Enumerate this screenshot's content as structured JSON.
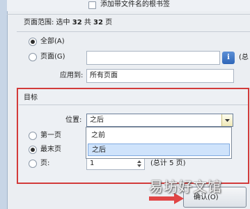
{
  "options": {
    "add_bookmark_checkbox_label": "添加带文件名的根书签"
  },
  "page_range": {
    "heading": "页面范围: 选中",
    "selected_count": "32",
    "total_word": "共",
    "total_count": "32",
    "unit": "页",
    "all_radio_label": "全部(A)",
    "pages_radio_label": "页面(G)",
    "pages_input_value": "",
    "total_hint_partial": "(总",
    "info_icon": "info-icon",
    "apply_to_label": "应用到:",
    "apply_to_value": "所有页面"
  },
  "target": {
    "group_title": "目标",
    "position_label": "位置:",
    "position_value": "之后",
    "first_page_label": "第一页",
    "last_page_label": "最末页",
    "page_label": "页:",
    "page_spinner_value": "1",
    "page_total_hint": "(总计 5 页)",
    "dropdown_options": [
      "之前",
      "之后"
    ],
    "dropdown_selected_index": 1
  },
  "footer": {
    "ok_button_label": "确认(O)"
  },
  "watermark": "易坊好文馆",
  "colors": {
    "highlight_border": "#d23a3a",
    "arrow": "#e04545",
    "selection": "#cfe3fb"
  }
}
